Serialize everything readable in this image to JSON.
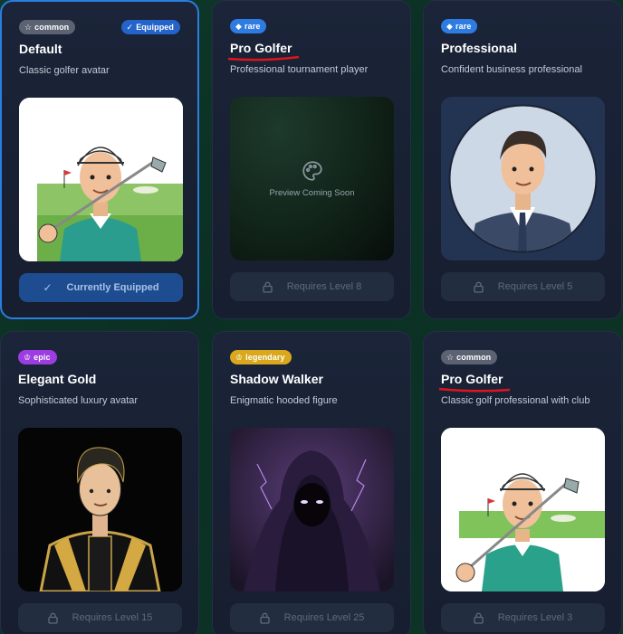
{
  "cards": [
    {
      "rarity": "common",
      "title": "Default",
      "description": "Classic golfer avatar",
      "equipped_badge": "Equipped",
      "button": "Currently Equipped",
      "status": "equipped"
    },
    {
      "rarity": "rare",
      "title": "Pro Golfer",
      "description": "Professional tournament player",
      "preview_text": "Preview Coming Soon",
      "button": "Requires Level 8",
      "status": "locked"
    },
    {
      "rarity": "rare",
      "title": "Professional",
      "description": "Confident business professional",
      "button": "Requires Level 5",
      "status": "locked"
    },
    {
      "rarity": "epic",
      "title": "Elegant Gold",
      "description": "Sophisticated luxury avatar",
      "button": "Requires Level 15",
      "status": "locked"
    },
    {
      "rarity": "legendary",
      "title": "Shadow Walker",
      "description": "Enigmatic hooded figure",
      "button": "Requires Level 25",
      "status": "locked"
    },
    {
      "rarity": "common",
      "title": "Pro Golfer",
      "description": "Classic golf professional with club",
      "button": "Requires Level 3",
      "status": "locked"
    }
  ],
  "colors": {
    "common": "#5b6272",
    "rare": "#2e7be2",
    "epic": "#9b3de0",
    "legendary": "#d9a81d",
    "equipped_border": "#2b7de0",
    "annotation_red": "#e0141e"
  },
  "icons": {
    "common": "star-icon",
    "rare": "diamond-icon",
    "epic": "crown-icon",
    "legendary": "crown-icon",
    "locked": "lock-icon",
    "equipped": "check-icon",
    "preview": "palette-icon"
  }
}
